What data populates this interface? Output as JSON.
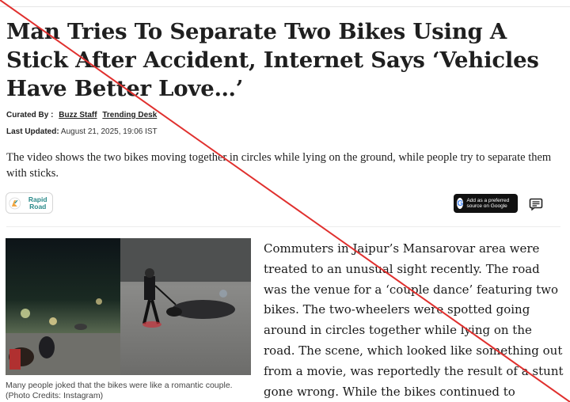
{
  "article": {
    "headline": "Man Tries To Separate Two Bikes Using A Stick After Accident, Internet Says ‘Vehicles Have Better Love…’",
    "curated_label": "Curated By :",
    "authors": [
      "Buzz Staff",
      "Trending Desk"
    ],
    "updated_label": "Last Updated:",
    "updated_value": "August 21, 2025, 19:06 IST",
    "dek": "The video shows the two bikes moving together in circles while lying on the ground, while people try to separate them with sticks.",
    "rapid_road": "Rapid Road",
    "google_button": "Add as a preferred source on Google",
    "google_icon": "google-g-icon",
    "comment_icon": "comment-icon",
    "image_caption": "Many people joked that the bikes were like a romantic couple. (Photo Credits: Instagram)",
    "body": "Commuters in Jaipur’s Mansarovar area were treated to an unusual sight recently. The road was the venue for a ‘couple dance’ featuring two bikes. The two-wheelers were spotted going around in circles together while lying on the road. The scene, which looked like something out from a movie, was reportedly the result of a stunt gone wrong. While the bikes continued to"
  },
  "overlay": {
    "strike_color": "#e0302e"
  }
}
